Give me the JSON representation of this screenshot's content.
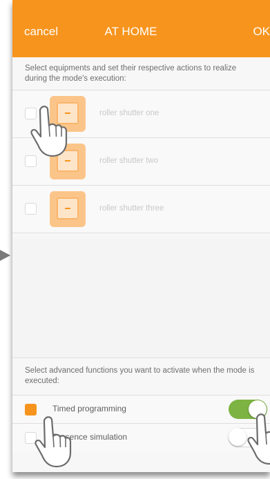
{
  "header": {
    "cancel_label": "cancel",
    "title": "AT HOME",
    "ok_label": "OK",
    "color": "#f7941d"
  },
  "equipment_section": {
    "instruction": "Select equipments and set their respective actions to realize during the mode's execution:",
    "items": [
      {
        "label": "roller shutter one",
        "checked": false,
        "icon": "roller-shutter-icon"
      },
      {
        "label": "roller shutter two",
        "checked": false,
        "icon": "roller-shutter-icon"
      },
      {
        "label": "roller shutter three",
        "checked": false,
        "icon": "roller-shutter-icon"
      }
    ]
  },
  "functions_section": {
    "instruction": "Select advanced functions you want to activate when the mode is executed:",
    "items": [
      {
        "label": "Timed programming",
        "checked": true,
        "toggle_on": true
      },
      {
        "label": "Presence simulation",
        "checked": false,
        "toggle_on": false
      }
    ]
  },
  "colors": {
    "accent": "#f7941d",
    "toggle_on": "#7cb342"
  }
}
